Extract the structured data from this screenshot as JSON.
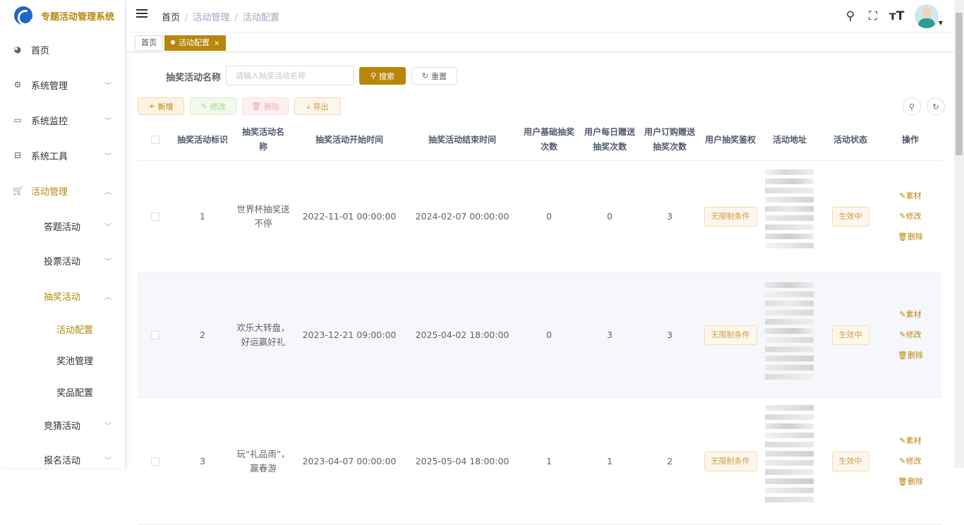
{
  "app": {
    "title": "专题活动管理系统"
  },
  "sidebar": {
    "items": [
      {
        "label": "首页",
        "icon": "dashboard-icon"
      },
      {
        "label": "系统管理",
        "icon": "gear-icon"
      },
      {
        "label": "系统监控",
        "icon": "monitor-icon"
      },
      {
        "label": "系统工具",
        "icon": "toolbox-icon"
      },
      {
        "label": "活动管理",
        "icon": "cart-icon"
      },
      {
        "label": "答题活动"
      },
      {
        "label": "投票活动"
      },
      {
        "label": "抽奖活动"
      },
      {
        "label": "活动配置"
      },
      {
        "label": "奖池管理"
      },
      {
        "label": "奖品配置"
      },
      {
        "label": "竞猜活动"
      },
      {
        "label": "报名活动"
      }
    ]
  },
  "breadcrumb": {
    "home": "首页",
    "level1": "活动管理",
    "level2": "活动配置",
    "sep": "/"
  },
  "tags": {
    "home": "首页",
    "current": "活动配置",
    "close": "×"
  },
  "search": {
    "label": "抽奖活动名称",
    "placeholder": "请输入抽奖活动名称",
    "search_btn": "搜索",
    "reset_btn": "重置"
  },
  "toolbar": {
    "add": "新增",
    "edit": "修改",
    "delete": "删除",
    "export": "导出"
  },
  "table": {
    "headers": [
      "抽奖活动标识",
      "抽奖活动名称",
      "抽奖活动开始时间",
      "抽奖活动结束时间",
      "用户基础抽奖次数",
      "用户每日赠送抽奖次数",
      "用户订购赠送抽奖次数",
      "用户抽奖鉴权",
      "活动地址",
      "活动状态",
      "操作"
    ],
    "rows": [
      {
        "id": "1",
        "name": "世界杯抽奖送不停",
        "start": "2022-11-01 00:00:00",
        "end": "2024-02-07 00:00:00",
        "base": "0",
        "daily": "0",
        "order": "3",
        "auth": "无限制条件",
        "status": "生效中"
      },
      {
        "id": "2",
        "name": "欢乐大转盘，好运赢好礼",
        "start": "2023-12-21 09:00:00",
        "end": "2025-04-02 18:00:00",
        "base": "0",
        "daily": "3",
        "order": "3",
        "auth": "无限制条件",
        "status": "生效中"
      },
      {
        "id": "3",
        "name": "玩“礼品雨”，赢春游",
        "start": "2023-04-07 00:00:00",
        "end": "2025-05-04 18:00:00",
        "base": "1",
        "daily": "1",
        "order": "2",
        "auth": "无限制条件",
        "status": "生效中"
      }
    ],
    "ops": {
      "material": "素材",
      "edit": "修改",
      "delete": "删除"
    }
  },
  "colors": {
    "accent": "#b8860b",
    "text": "#606266"
  }
}
